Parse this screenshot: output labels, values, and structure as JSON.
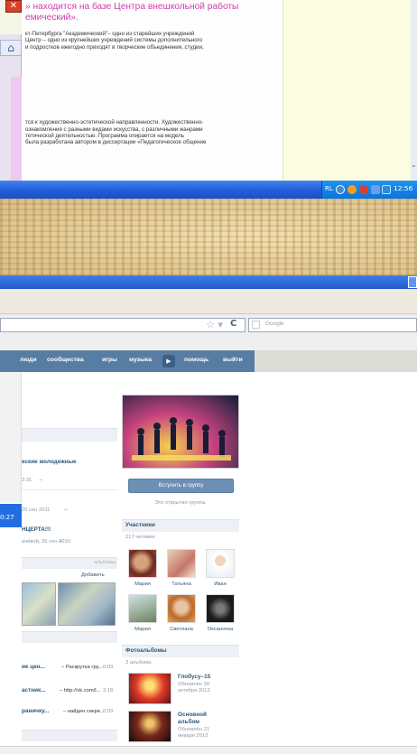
{
  "colors": {
    "heading_pink": "#d23dac",
    "vk_nav": "#587da3",
    "vk_link": "#2b587a",
    "taskbar": "#245edb",
    "papyrus": "#e5cf9b"
  },
  "doc_window": {
    "close_icon": "close-icon",
    "home_icon": "home-icon",
    "heading_line1": "» находится на базе Центра внешкольной работы",
    "heading_line2": "емический».",
    "para1_line1": "кт-Петербурга \"Академический\"– одно из старейших учреждений",
    "para1_line2": "Центр – одно из крупнейших учреждений системы дополнительного",
    "para1_line3": "и подростков ежегодно приходят в творческие объединения, студии,",
    "para2_line1": "тся к художественно-эстетической направленности. Художественно-",
    "para2_line2": "ознакомления с разными видами искусства, с различными жанрами",
    "para2_line3": "тетической деятельностью. Программа опирается на модель",
    "para2_line4": "была разработана автором в диссертации «Педагогическое общение"
  },
  "taskbar": {
    "lang": "RL",
    "clock": "12:56"
  },
  "left_clock": "0:27",
  "browser": {
    "search_placeholder": "Google",
    "star_icon": "star-icon",
    "refresh_icon": "refresh-icon"
  },
  "vk": {
    "nav": {
      "item1": "люди",
      "item2": "сообщества",
      "item3": "игры",
      "item4": "музыка",
      "item5": "помощь",
      "item6": "выйти"
    },
    "wall": {
      "post1_title": "еские молодежные",
      "post1_time": "3:31",
      "post2_time": "20 сен 2011",
      "post3_title": "НЦЕРТА!!!",
      "post3_meta": "ачёвой, 26 сен 2010"
    },
    "albums_header": "альбомы",
    "albums_add": "Добавить",
    "links": [
      {
        "left": "ие цен...",
        "right": "– Раскрутка гру...",
        "time": "0:03"
      },
      {
        "left": "астник...",
        "right": "– http://vk.com/l...",
        "time": "3:18"
      },
      {
        "left": "раничку...",
        "right": "– найден секре...",
        "time": "0:03"
      }
    ],
    "group": {
      "join_button": "Вступить в группу",
      "open_group": "Это открытая группа.",
      "members_header": "Участники",
      "members_count": "217 человек",
      "members": [
        {
          "name": "Мария"
        },
        {
          "name": "Татьяна"
        },
        {
          "name": "Иван"
        },
        {
          "name": "Мария"
        },
        {
          "name": "Светлана"
        },
        {
          "name": "Оксаночка"
        }
      ],
      "albums_header": "Фотоальбомы",
      "albums_count": "3 альбома",
      "albums": [
        {
          "title": "Глобусу–15",
          "updated_line1": "Обновлён 30",
          "updated_line2": "октября 2012"
        },
        {
          "title_line1": "Основной",
          "title_line2": "альбом",
          "updated_line1": "Обновлён 21",
          "updated_line2": "января 2013"
        }
      ]
    }
  }
}
